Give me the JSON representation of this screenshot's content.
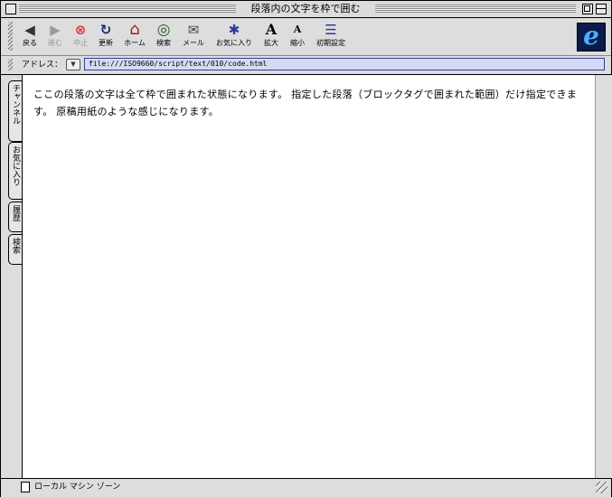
{
  "window": {
    "title": "段落内の文字を枠で囲む"
  },
  "toolbar": {
    "items": [
      {
        "label": "戻る",
        "icon": "back-arrow-icon",
        "glyph": "◀",
        "enabled": true
      },
      {
        "label": "進む",
        "icon": "forward-arrow-icon",
        "glyph": "▶",
        "enabled": false
      },
      {
        "label": "中止",
        "icon": "stop-icon",
        "glyph": "⊗",
        "enabled": false
      },
      {
        "label": "更新",
        "icon": "refresh-icon",
        "glyph": "↻",
        "enabled": true
      },
      {
        "label": "ホーム",
        "icon": "home-icon",
        "glyph": "⌂",
        "enabled": true
      },
      {
        "label": "検索",
        "icon": "search-icon",
        "glyph": "◎",
        "enabled": true
      },
      {
        "label": "メール",
        "icon": "mail-icon",
        "glyph": "✉",
        "enabled": true
      },
      {
        "label": "お気に入り",
        "icon": "favorites-icon",
        "glyph": "✱",
        "enabled": true
      },
      {
        "label": "拡大",
        "icon": "text-larger-icon",
        "glyph": "A",
        "enabled": true
      },
      {
        "label": "縮小",
        "icon": "text-smaller-icon",
        "glyph": "A",
        "enabled": true
      },
      {
        "label": "初期設定",
        "icon": "preferences-icon",
        "glyph": "☰",
        "enabled": true
      }
    ]
  },
  "address": {
    "label": "アドレス：",
    "url": "file:///ISO9660/script/text/010/code.html"
  },
  "side_tabs": [
    "チャンネル",
    "お気に入り",
    "履歴",
    "検索"
  ],
  "content": {
    "paragraph": "ここの段落の文字は全て枠で囲まれた状態になります。 指定した段落（ブロックタグで囲まれた範囲）だけ指定できます。 原稿用紙のような感じになります。"
  },
  "status": {
    "zone": "ローカル マシン ゾーン"
  },
  "colors": {
    "chrome": "#dddddd",
    "address_field": "#d4dcf4",
    "stop_icon": "#d23c3c",
    "ie_logo_bg": "#0a1a4a",
    "ie_logo_fg": "#4ab0ff"
  }
}
